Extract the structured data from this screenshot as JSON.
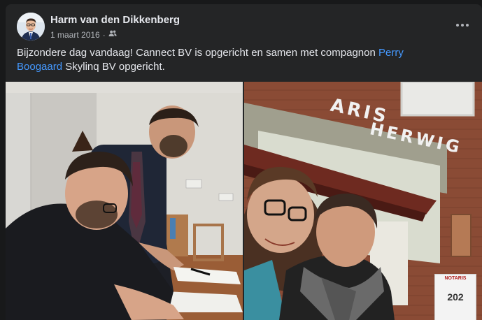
{
  "post": {
    "author": "Harm van den Dikkenberg",
    "date": "1 maart 2016",
    "separator": "·",
    "audience_icon": "friends-icon",
    "more_icon": "more-dots-icon",
    "text_before_link": "Bijzondere dag vandaag! Cannect BV is opgericht en samen met compagnon ",
    "link_text": "Perry Boogaard",
    "text_after_link": " Skylinq BV opgericht."
  },
  "photos": {
    "right": {
      "sign_top": "ARIS",
      "sign_bottom": "HERWIG",
      "plate_label": "NOTARIS",
      "plate_number": "202"
    }
  },
  "colors": {
    "page_bg": "#18191a",
    "card_bg": "#242526",
    "primary_text": "#e4e6eb",
    "secondary_text": "#b0b3b8",
    "link": "#4599ff"
  }
}
